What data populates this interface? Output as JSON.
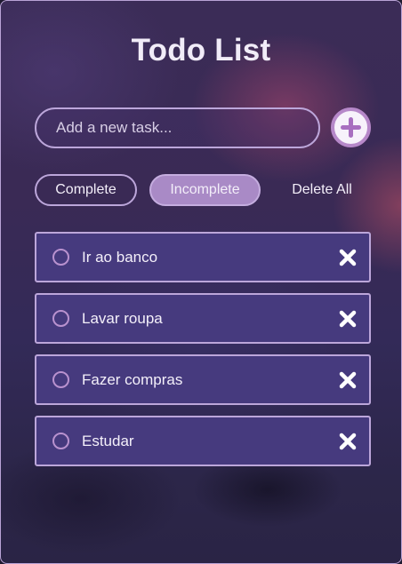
{
  "app": {
    "title": "Todo List"
  },
  "new_task": {
    "placeholder": "Add a new task...",
    "value": "",
    "add_icon": "plus-icon"
  },
  "filters": {
    "complete_label": "Complete",
    "incomplete_label": "Incomplete",
    "delete_all_label": "Delete All",
    "active": "Incomplete"
  },
  "tasks": [
    {
      "text": "Ir ao banco",
      "done": false
    },
    {
      "text": "Lavar roupa",
      "done": false
    },
    {
      "text": "Fazer compras",
      "done": false
    },
    {
      "text": "Estudar",
      "done": false
    }
  ],
  "icons": {
    "checkbox": "circle-checkbox-icon",
    "delete": "close-icon"
  },
  "colors": {
    "accent": "#a98ac6",
    "border": "#bca6da",
    "task_bg": "#463a7e",
    "text": "#f4f0fa"
  }
}
